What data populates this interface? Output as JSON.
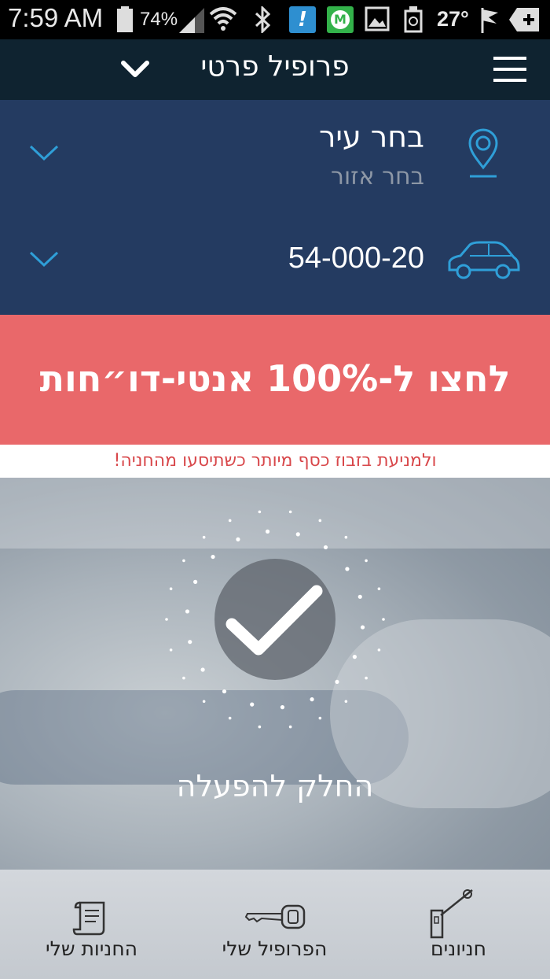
{
  "status_bar": {
    "time": "7:59 AM",
    "battery": "74%",
    "temperature": "27°",
    "icons": [
      "battery-icon",
      "signal-icon",
      "wifi-icon",
      "bluetooth-icon",
      "notification-icon",
      "app-icon",
      "gallery-icon",
      "recycle-icon",
      "flag-icon",
      "add-icon"
    ]
  },
  "header": {
    "title": "פרופיל פרטי",
    "menu_icon": "hamburger-icon",
    "dropdown_icon": "chevron-down-icon"
  },
  "selectors": {
    "city": "בחר עיר",
    "area": "בחר אזור",
    "plate": "54-000-20",
    "location_icon": "location-pin-icon",
    "car_icon": "car-icon",
    "accent": "#2f9fd8"
  },
  "promo": {
    "headline": "לחצו ל-100% אנטי-דו״חות",
    "subtext": "ולמניעת בזבוז כסף מיותר כשתיסעו מהחניה!",
    "bg": "#e9686a"
  },
  "hero": {
    "slide_label": "החלק להפעלה",
    "check_icon": "checkmark-icon"
  },
  "bottom_nav": {
    "items": [
      {
        "label": "החניות שלי",
        "icon": "receipt-scroll-icon"
      },
      {
        "label": "הפרופיל שלי",
        "icon": "car-key-icon"
      },
      {
        "label": "חניונים",
        "icon": "parking-barrier-icon"
      }
    ]
  }
}
